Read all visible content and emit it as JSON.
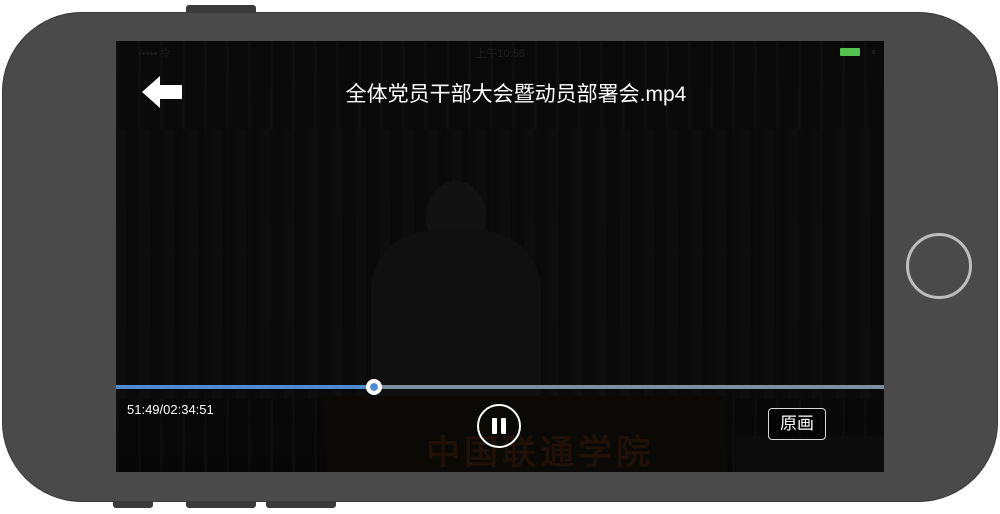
{
  "status_bar": {
    "carrier": "••••• 令",
    "time": "上午10:56",
    "battery_color": "#52c34f"
  },
  "video": {
    "title": "全体党员干部大会暨动员部署会.mp4",
    "backdrop_text": "中国联通学院",
    "progress_fraction": 0.3353,
    "current_time": "51:49",
    "duration": "02:34:51",
    "time_readout": "51:49/02:34:51"
  },
  "controls": {
    "back_icon": "back-arrow-icon",
    "pause_icon": "pause-icon",
    "quality_label": "原画"
  },
  "colors": {
    "progress_played": "#4f8ad1",
    "progress_remaining": "#7d8ea3",
    "phone_body": "#4a4a4a"
  }
}
